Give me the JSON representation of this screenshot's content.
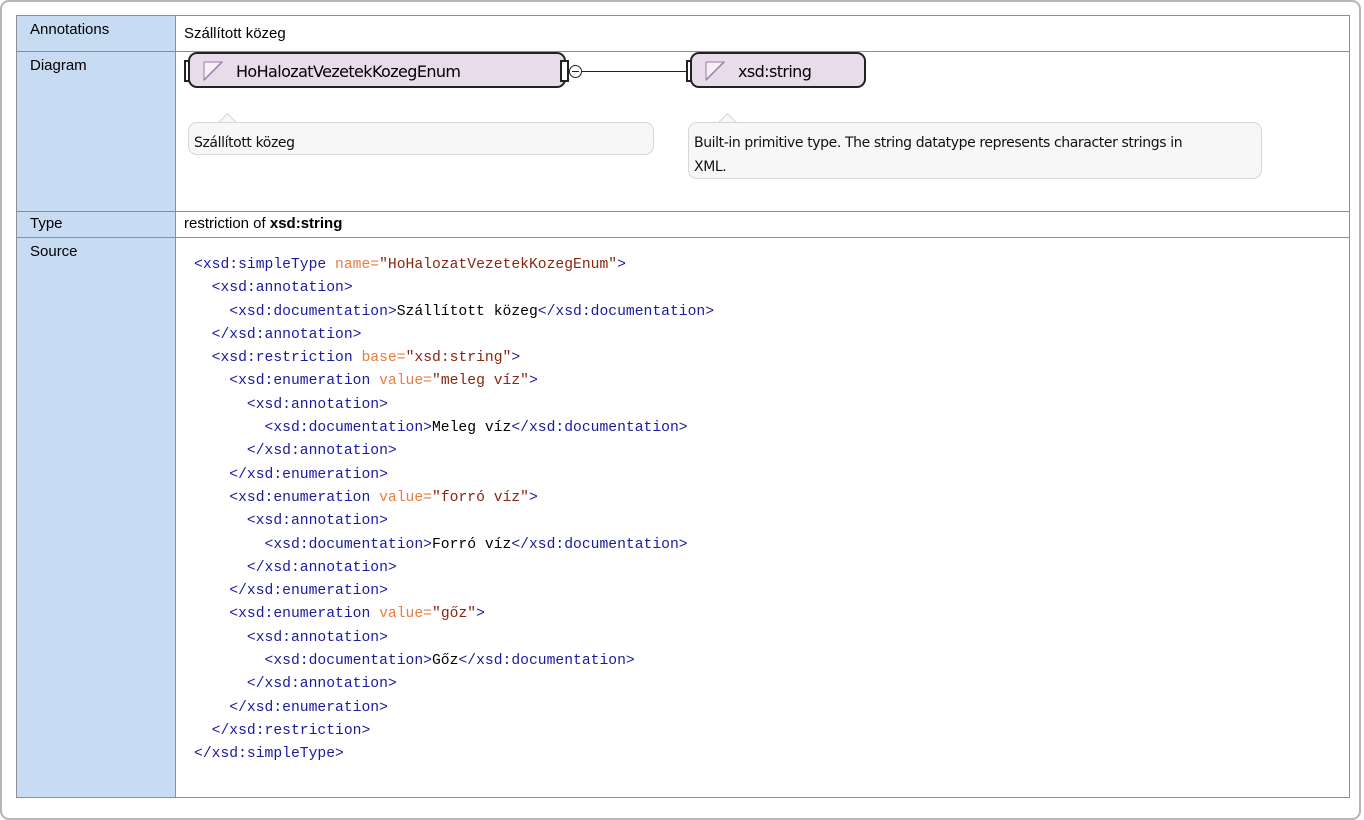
{
  "rows": {
    "annotations": {
      "label": "Annotations",
      "value": "Szállított közeg"
    },
    "diagram": {
      "label": "Diagram",
      "main_node": {
        "name": "HoHalozatVezetekKozegEnum",
        "doc": "Szállított közeg",
        "icon": "simple-type-icon"
      },
      "base_node": {
        "name": "xsd:string",
        "doc": "Built-in primitive type. The string datatype represents character strings in XML.",
        "icon": "simple-type-icon"
      },
      "colors": {
        "node_fill": "#e9dcea",
        "label_bg": "#c7dbf3",
        "note_fill": "#f8f7f7"
      }
    },
    "type": {
      "label": "Type",
      "prefix": "restriction of",
      "base": "xsd:string"
    },
    "source": {
      "label": "Source",
      "lines": [
        {
          "indent": "",
          "parts": [
            [
              "tag",
              "<xsd:simpleType "
            ],
            [
              "attr",
              "name="
            ],
            [
              "aval",
              "\"HoHalozatVezetekKozegEnum\""
            ],
            [
              "tag",
              ">"
            ]
          ]
        },
        {
          "indent": "  ",
          "parts": [
            [
              "tag",
              "<xsd:annotation>"
            ]
          ]
        },
        {
          "indent": "    ",
          "parts": [
            [
              "tag",
              "<xsd:documentation>"
            ],
            [
              "txt",
              "Szállított közeg"
            ],
            [
              "tag",
              "</xsd:documentation>"
            ]
          ]
        },
        {
          "indent": "  ",
          "parts": [
            [
              "tag",
              "</xsd:annotation>"
            ]
          ]
        },
        {
          "indent": "  ",
          "parts": [
            [
              "tag",
              "<xsd:restriction "
            ],
            [
              "attr",
              "base="
            ],
            [
              "aval",
              "\"xsd:string\""
            ],
            [
              "tag",
              ">"
            ]
          ]
        },
        {
          "indent": "    ",
          "parts": [
            [
              "tag",
              "<xsd:enumeration "
            ],
            [
              "attr",
              "value="
            ],
            [
              "aval",
              "\"meleg víz\""
            ],
            [
              "tag",
              ">"
            ]
          ]
        },
        {
          "indent": "      ",
          "parts": [
            [
              "tag",
              "<xsd:annotation>"
            ]
          ]
        },
        {
          "indent": "        ",
          "parts": [
            [
              "tag",
              "<xsd:documentation>"
            ],
            [
              "txt",
              "Meleg víz"
            ],
            [
              "tag",
              "</xsd:documentation>"
            ]
          ]
        },
        {
          "indent": "      ",
          "parts": [
            [
              "tag",
              "</xsd:annotation>"
            ]
          ]
        },
        {
          "indent": "    ",
          "parts": [
            [
              "tag",
              "</xsd:enumeration>"
            ]
          ]
        },
        {
          "indent": "    ",
          "parts": [
            [
              "tag",
              "<xsd:enumeration "
            ],
            [
              "attr",
              "value="
            ],
            [
              "aval",
              "\"forró víz\""
            ],
            [
              "tag",
              ">"
            ]
          ]
        },
        {
          "indent": "      ",
          "parts": [
            [
              "tag",
              "<xsd:annotation>"
            ]
          ]
        },
        {
          "indent": "        ",
          "parts": [
            [
              "tag",
              "<xsd:documentation>"
            ],
            [
              "txt",
              "Forró víz"
            ],
            [
              "tag",
              "</xsd:documentation>"
            ]
          ]
        },
        {
          "indent": "      ",
          "parts": [
            [
              "tag",
              "</xsd:annotation>"
            ]
          ]
        },
        {
          "indent": "    ",
          "parts": [
            [
              "tag",
              "</xsd:enumeration>"
            ]
          ]
        },
        {
          "indent": "    ",
          "parts": [
            [
              "tag",
              "<xsd:enumeration "
            ],
            [
              "attr",
              "value="
            ],
            [
              "aval",
              "\"gőz\""
            ],
            [
              "tag",
              ">"
            ]
          ]
        },
        {
          "indent": "      ",
          "parts": [
            [
              "tag",
              "<xsd:annotation>"
            ]
          ]
        },
        {
          "indent": "        ",
          "parts": [
            [
              "tag",
              "<xsd:documentation>"
            ],
            [
              "txt",
              "Gőz"
            ],
            [
              "tag",
              "</xsd:documentation>"
            ]
          ]
        },
        {
          "indent": "      ",
          "parts": [
            [
              "tag",
              "</xsd:annotation>"
            ]
          ]
        },
        {
          "indent": "    ",
          "parts": [
            [
              "tag",
              "</xsd:enumeration>"
            ]
          ]
        },
        {
          "indent": "  ",
          "parts": [
            [
              "tag",
              "</xsd:restriction>"
            ]
          ]
        },
        {
          "indent": "",
          "parts": [
            [
              "tag",
              "</xsd:simpleType>"
            ]
          ]
        }
      ]
    }
  }
}
